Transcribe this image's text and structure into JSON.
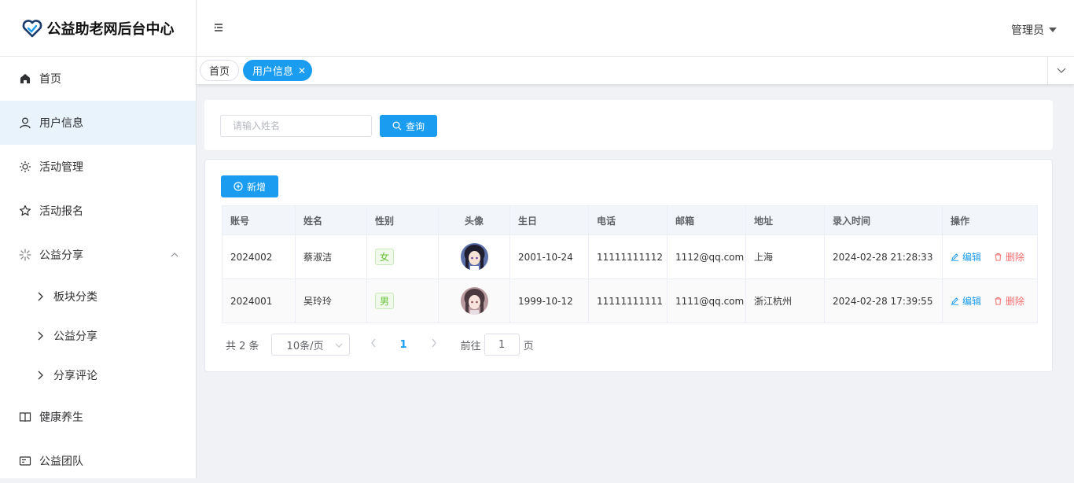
{
  "app": {
    "title": "公益助老网后台中心",
    "brand_color": "#1a9cf0"
  },
  "sidebar": {
    "items": [
      {
        "label": "首页",
        "icon": "home-icon"
      },
      {
        "label": "用户信息",
        "icon": "user-icon"
      },
      {
        "label": "活动管理",
        "icon": "sun-icon"
      },
      {
        "label": "活动报名",
        "icon": "star-icon"
      },
      {
        "label": "公益分享",
        "icon": "sparkle-icon"
      },
      {
        "label": "健康养生",
        "icon": "book-icon"
      },
      {
        "label": "公益团队",
        "icon": "card-icon"
      }
    ],
    "submenu": [
      {
        "label": "板块分类"
      },
      {
        "label": "公益分享"
      },
      {
        "label": "分享评论"
      }
    ]
  },
  "header": {
    "user": "管理员"
  },
  "tags": {
    "home": "首页",
    "current": "用户信息"
  },
  "search": {
    "placeholder": "请输入姓名",
    "button": "查询"
  },
  "toolbar": {
    "add_label": "新增"
  },
  "table": {
    "columns": [
      "账号",
      "姓名",
      "性别",
      "头像",
      "生日",
      "电话",
      "邮箱",
      "地址",
      "录入时间",
      "操作"
    ],
    "rows": [
      {
        "account": "2024002",
        "name": "蔡淑洁",
        "gender": "女",
        "birthday": "2001-10-24",
        "phone": "11111111112",
        "email": "1112@qq.com",
        "address": "上海",
        "created": "2024-02-28 21:28:33"
      },
      {
        "account": "2024001",
        "name": "吴玲玲",
        "gender": "男",
        "birthday": "1999-10-12",
        "phone": "11111111111",
        "email": "1111@qq.com",
        "address": "浙江杭州",
        "created": "2024-02-28 17:39:55"
      }
    ],
    "actions": {
      "edit": "编辑",
      "delete": "删除"
    }
  },
  "pagination": {
    "total": "共 2 条",
    "page_size": "10条/页",
    "current": "1",
    "goto_prefix": "前往",
    "goto_value": "1",
    "goto_suffix": "页"
  }
}
